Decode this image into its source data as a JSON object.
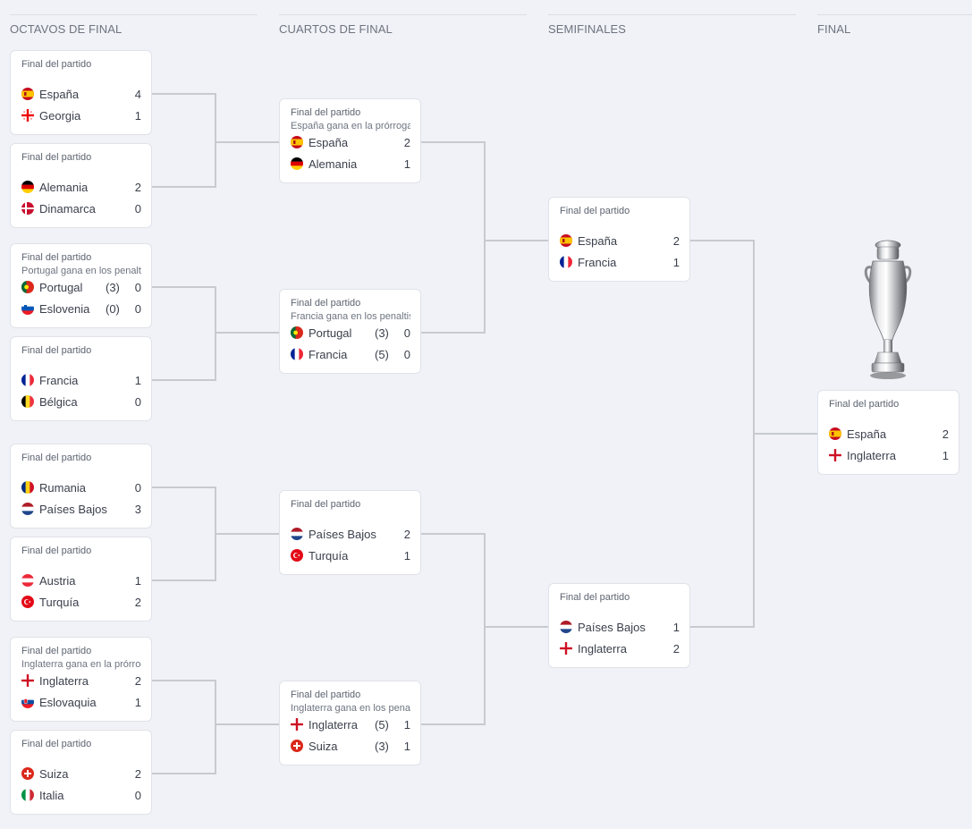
{
  "rounds": [
    {
      "label": "OCTAVOS DE FINAL"
    },
    {
      "label": "CUARTOS DE FINAL"
    },
    {
      "label": "SEMIFINALES"
    },
    {
      "label": "FINAL"
    }
  ],
  "status_label": "Final del partido",
  "matches": {
    "r16": [
      {
        "status": "Final del partido",
        "note": "",
        "home": {
          "team": "España",
          "flag": "spain-flag",
          "score": "4",
          "pens": ""
        },
        "away": {
          "team": "Georgia",
          "flag": "georgia-flag",
          "score": "1",
          "pens": ""
        }
      },
      {
        "status": "Final del partido",
        "note": "",
        "home": {
          "team": "Alemania",
          "flag": "germany-flag",
          "score": "2",
          "pens": ""
        },
        "away": {
          "team": "Dinamarca",
          "flag": "denmark-flag",
          "score": "0",
          "pens": ""
        }
      },
      {
        "status": "Final del partido",
        "note": "Portugal gana en los penaltis",
        "home": {
          "team": "Portugal",
          "flag": "portugal-flag",
          "score": "0",
          "pens": "(3)"
        },
        "away": {
          "team": "Eslovenia",
          "flag": "slovenia-flag",
          "score": "0",
          "pens": "(0)"
        }
      },
      {
        "status": "Final del partido",
        "note": "",
        "home": {
          "team": "Francia",
          "flag": "france-flag",
          "score": "1",
          "pens": ""
        },
        "away": {
          "team": "Bélgica",
          "flag": "belgium-flag",
          "score": "0",
          "pens": ""
        }
      },
      {
        "status": "Final del partido",
        "note": "",
        "home": {
          "team": "Rumania",
          "flag": "romania-flag",
          "score": "0",
          "pens": ""
        },
        "away": {
          "team": "Países Bajos",
          "flag": "netherlands-flag",
          "score": "3",
          "pens": ""
        }
      },
      {
        "status": "Final del partido",
        "note": "",
        "home": {
          "team": "Austria",
          "flag": "austria-flag",
          "score": "1",
          "pens": ""
        },
        "away": {
          "team": "Turquía",
          "flag": "turkey-flag",
          "score": "2",
          "pens": ""
        }
      },
      {
        "status": "Final del partido",
        "note": "Inglaterra gana en la prórroga",
        "home": {
          "team": "Inglaterra",
          "flag": "england-flag",
          "score": "2",
          "pens": ""
        },
        "away": {
          "team": "Eslovaquia",
          "flag": "slovakia-flag",
          "score": "1",
          "pens": ""
        }
      },
      {
        "status": "Final del partido",
        "note": "",
        "home": {
          "team": "Suiza",
          "flag": "switzerland-flag",
          "score": "2",
          "pens": ""
        },
        "away": {
          "team": "Italia",
          "flag": "italy-flag",
          "score": "0",
          "pens": ""
        }
      }
    ],
    "qf": [
      {
        "status": "Final del partido",
        "note": "España gana en la prórroga",
        "home": {
          "team": "España",
          "flag": "spain-flag",
          "score": "2",
          "pens": ""
        },
        "away": {
          "team": "Alemania",
          "flag": "germany-flag",
          "score": "1",
          "pens": ""
        }
      },
      {
        "status": "Final del partido",
        "note": "Francia gana en los penaltis",
        "home": {
          "team": "Portugal",
          "flag": "portugal-flag",
          "score": "0",
          "pens": "(3)"
        },
        "away": {
          "team": "Francia",
          "flag": "france-flag",
          "score": "0",
          "pens": "(5)"
        }
      },
      {
        "status": "Final del partido",
        "note": "",
        "home": {
          "team": "Países Bajos",
          "flag": "netherlands-flag",
          "score": "2",
          "pens": ""
        },
        "away": {
          "team": "Turquía",
          "flag": "turkey-flag",
          "score": "1",
          "pens": ""
        }
      },
      {
        "status": "Final del partido",
        "note": "Inglaterra gana en los penaltis",
        "home": {
          "team": "Inglaterra",
          "flag": "england-flag",
          "score": "1",
          "pens": "(5)"
        },
        "away": {
          "team": "Suiza",
          "flag": "switzerland-flag",
          "score": "1",
          "pens": "(3)"
        }
      }
    ],
    "sf": [
      {
        "status": "Final del partido",
        "note": "",
        "home": {
          "team": "España",
          "flag": "spain-flag",
          "score": "2",
          "pens": ""
        },
        "away": {
          "team": "Francia",
          "flag": "france-flag",
          "score": "1",
          "pens": ""
        }
      },
      {
        "status": "Final del partido",
        "note": "",
        "home": {
          "team": "Países Bajos",
          "flag": "netherlands-flag",
          "score": "1",
          "pens": ""
        },
        "away": {
          "team": "Inglaterra",
          "flag": "england-flag",
          "score": "2",
          "pens": ""
        }
      }
    ],
    "final": [
      {
        "status": "Final del partido",
        "note": "",
        "home": {
          "team": "España",
          "flag": "spain-flag",
          "score": "2",
          "pens": ""
        },
        "away": {
          "team": "Inglaterra",
          "flag": "england-flag",
          "score": "1",
          "pens": ""
        }
      }
    ]
  },
  "trophy_icon": "trophy-icon",
  "colors": {
    "background": "#f1f2f7",
    "card": "#ffffff",
    "connector": "#c7cad1",
    "header_text": "#6d7480"
  }
}
